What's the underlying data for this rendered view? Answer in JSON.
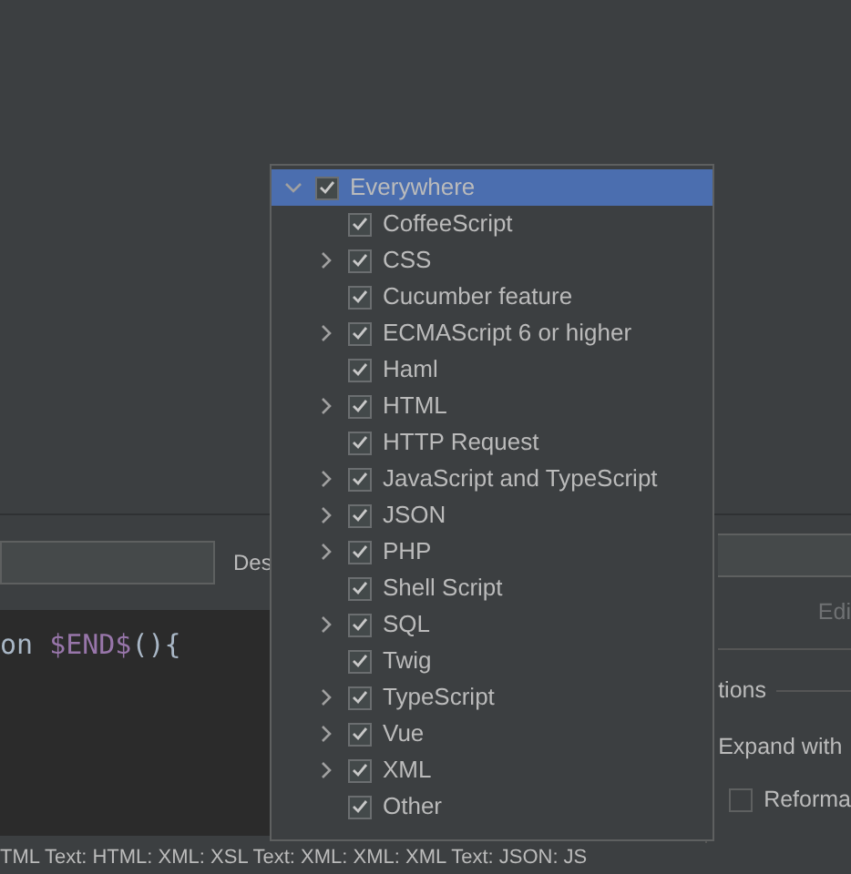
{
  "left_panel": {
    "description_label": "Des",
    "editor": {
      "tokens": [
        {
          "text": "on",
          "kind": "plain"
        },
        {
          "text": "$END$",
          "kind": "variable"
        },
        {
          "text": "(){",
          "kind": "plain"
        }
      ]
    }
  },
  "right_panel": {
    "edit_button": "Edi",
    "options_heading": "tions",
    "expand_label": "Expand with",
    "reformat": {
      "label": "Reforma",
      "checked": false
    }
  },
  "context_line": "TML Text: HTML: XML: XSL Text: XML: XML: XML Text: JSON: JS",
  "context_popup": {
    "tree": [
      {
        "label": "Everywhere",
        "checked": true,
        "expanded": true,
        "selected": true,
        "children": [
          {
            "label": "CoffeeScript",
            "checked": true,
            "selected": false
          },
          {
            "label": "CSS",
            "checked": true,
            "expanded": false,
            "selected": false
          },
          {
            "label": "Cucumber feature",
            "checked": true,
            "selected": false
          },
          {
            "label": "ECMAScript 6 or higher",
            "checked": true,
            "expanded": false,
            "selected": false
          },
          {
            "label": "Haml",
            "checked": true,
            "selected": false
          },
          {
            "label": "HTML",
            "checked": true,
            "expanded": false,
            "selected": false
          },
          {
            "label": "HTTP Request",
            "checked": true,
            "selected": false
          },
          {
            "label": "JavaScript and TypeScript",
            "checked": true,
            "expanded": false,
            "selected": false
          },
          {
            "label": "JSON",
            "checked": true,
            "expanded": false,
            "selected": false
          },
          {
            "label": "PHP",
            "checked": true,
            "expanded": false,
            "selected": false
          },
          {
            "label": "Shell Script",
            "checked": true,
            "selected": false
          },
          {
            "label": "SQL",
            "checked": true,
            "expanded": false,
            "selected": false
          },
          {
            "label": "Twig",
            "checked": true,
            "selected": false
          },
          {
            "label": "TypeScript",
            "checked": true,
            "expanded": false,
            "selected": false
          },
          {
            "label": "Vue",
            "checked": true,
            "expanded": false,
            "selected": false
          },
          {
            "label": "XML",
            "checked": true,
            "expanded": false,
            "selected": false
          },
          {
            "label": "Other",
            "checked": true,
            "selected": false
          }
        ]
      }
    ]
  }
}
